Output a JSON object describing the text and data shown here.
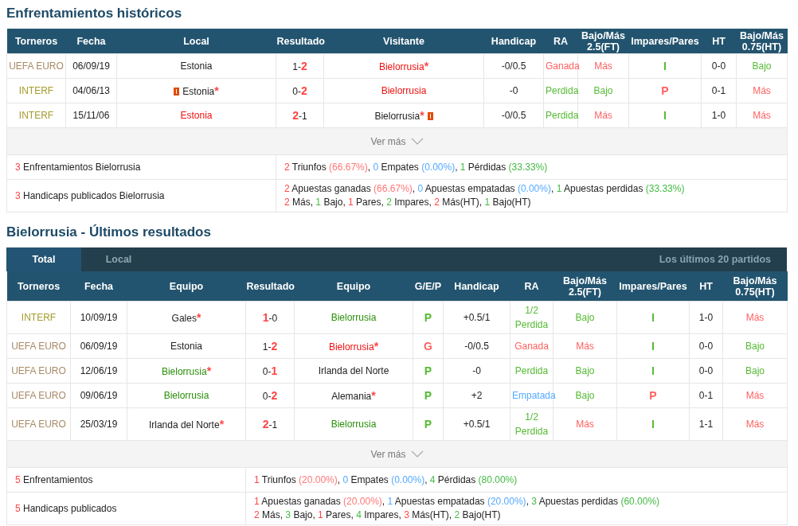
{
  "h2h": {
    "title": "Enfrentamientos históricos",
    "columns": [
      "Torneros",
      "Fecha",
      "Local",
      "Resultado",
      "Visitante",
      "Handicap",
      "RA",
      "Bajo/Más 2.5(FT)",
      "Impares/Pares",
      "HT",
      "Bajo/Más 0.75(HT)"
    ],
    "rows": [
      [
        {
          "text": "UEFA EURO",
          "color": "#a88a66"
        },
        {
          "text": "06/09/19"
        },
        {
          "text": "Estonia"
        },
        {
          "parts": [
            {
              "text": "1"
            },
            {
              "text": "-"
            },
            {
              "text": "2",
              "color": "#ff4444"
            }
          ]
        },
        {
          "parts": [
            {
              "text": "Bielorrusia",
              "color": "#ee1111"
            },
            {
              "text": "*",
              "color": "#ff4444"
            }
          ]
        },
        {
          "text": "-0/0.5"
        },
        {
          "text": "Ganada",
          "color": "#ff6060"
        },
        {
          "text": "Más",
          "color": "#ff6060"
        },
        {
          "text": "I",
          "color": "#55bb33"
        },
        {
          "text": "0-0"
        },
        {
          "text": "Bajo",
          "color": "#55bb33"
        }
      ],
      [
        {
          "text": "INTERF",
          "color": "#a59b2c"
        },
        {
          "text": "04/06/13"
        },
        {
          "card_before": true,
          "parts": [
            {
              "text": "Estonia"
            },
            {
              "text": "*",
              "color": "#ff4444"
            }
          ]
        },
        {
          "parts": [
            {
              "text": "0"
            },
            {
              "text": "-"
            },
            {
              "text": "2",
              "color": "#ff4444"
            }
          ]
        },
        {
          "text": "Bielorrusia",
          "color": "#ee1111"
        },
        {
          "text": "-0"
        },
        {
          "text": "Perdida",
          "color": "#55bb33"
        },
        {
          "text": "Bajo",
          "color": "#55bb33"
        },
        {
          "text": "P",
          "color": "#ff6060"
        },
        {
          "text": "0-1"
        },
        {
          "text": "Más",
          "color": "#ff6060"
        }
      ],
      [
        {
          "text": "INTERF",
          "color": "#a59b2c"
        },
        {
          "text": "15/11/06"
        },
        {
          "text": "Estonia",
          "color": "#ee1111"
        },
        {
          "parts": [
            {
              "text": "2",
              "color": "#ff4444"
            },
            {
              "text": "-"
            },
            {
              "text": "1"
            }
          ]
        },
        {
          "card_after": true,
          "parts": [
            {
              "text": "Bielorrusia"
            },
            {
              "text": "*",
              "color": "#ff4444"
            }
          ]
        },
        {
          "text": "-0/0.5"
        },
        {
          "text": "Perdida",
          "color": "#55bb33"
        },
        {
          "text": "Más",
          "color": "#ff6060"
        },
        {
          "text": "I",
          "color": "#55bb33"
        },
        {
          "text": "1-0"
        },
        {
          "text": "Más",
          "color": "#ff6060"
        }
      ]
    ],
    "more": "Ver más",
    "summary": [
      {
        "count": "3",
        "label": "Enfrentamientos Bielorrusia",
        "lines": [
          [
            {
              "text": "2",
              "color": "#ff4444"
            },
            {
              "text": " Triunfos "
            },
            {
              "text": "(66.67%)",
              "color": "#ff7777"
            },
            {
              "text": ", "
            },
            {
              "text": "0",
              "color": "#55aaff"
            },
            {
              "text": " Empates "
            },
            {
              "text": "(0.00%)",
              "color": "#55aaff"
            },
            {
              "text": ", "
            },
            {
              "text": "1",
              "color": "#44bb44"
            },
            {
              "text": " Pérdidas "
            },
            {
              "text": "(33.33%)",
              "color": "#44bb44"
            }
          ]
        ]
      },
      {
        "count": "3",
        "label": "Handicaps publicados Bielorrusia",
        "lines": [
          [
            {
              "text": "2",
              "color": "#ff4444"
            },
            {
              "text": " Apuestas ganadas "
            },
            {
              "text": "(66.67%)",
              "color": "#ff7777"
            },
            {
              "text": ", "
            },
            {
              "text": "0",
              "color": "#55aaff"
            },
            {
              "text": " Apuestas empatadas "
            },
            {
              "text": "(0.00%)",
              "color": "#55aaff"
            },
            {
              "text": ", "
            },
            {
              "text": "1",
              "color": "#44bb44"
            },
            {
              "text": " Apuestas perdidas "
            },
            {
              "text": "(33.33%)",
              "color": "#44bb44"
            }
          ],
          [
            {
              "text": "2",
              "color": "#ff4444"
            },
            {
              "text": " Más, "
            },
            {
              "text": "1",
              "color": "#44bb44"
            },
            {
              "text": " Bajo, "
            },
            {
              "text": "1",
              "color": "#ff4444"
            },
            {
              "text": " Pares, "
            },
            {
              "text": "2",
              "color": "#44bb44"
            },
            {
              "text": " Impares, "
            },
            {
              "text": "2",
              "color": "#ff4444"
            },
            {
              "text": " Más(HT), "
            },
            {
              "text": "1",
              "color": "#44bb44"
            },
            {
              "text": " Bajo(HT)"
            }
          ]
        ]
      }
    ]
  },
  "recent": {
    "title": "Bielorrusia - Últimos resultados",
    "tabs": [
      {
        "label": "Total",
        "selected": true
      },
      {
        "label": "Local",
        "selected": false
      }
    ],
    "note": "Los últimos 20 partidos",
    "columns": [
      "Torneros",
      "Fecha",
      "Equipo",
      "Resultado",
      "Equipo",
      "G/E/P",
      "Handicap",
      "RA",
      "Bajo/Más 2.5(FT)",
      "Impares/Pares",
      "HT",
      "Bajo/Más 0.75(HT)"
    ],
    "rows": [
      [
        {
          "text": "INTERF",
          "color": "#a59b2c"
        },
        {
          "text": "10/09/19"
        },
        {
          "parts": [
            {
              "text": "Gales"
            },
            {
              "text": "*",
              "color": "#ff4444"
            }
          ]
        },
        {
          "parts": [
            {
              "text": "1",
              "color": "#ff4444"
            },
            {
              "text": "-"
            },
            {
              "text": "0"
            }
          ]
        },
        {
          "text": "Bielorrusia",
          "color": "#2a8f0a"
        },
        {
          "text": "P",
          "color": "#55bb33"
        },
        {
          "text": "+0.5/1"
        },
        {
          "text": "1/2 Perdida",
          "color": "#55bb33"
        },
        {
          "text": "Bajo",
          "color": "#55bb33"
        },
        {
          "text": "I",
          "color": "#55bb33"
        },
        {
          "text": "1-0"
        },
        {
          "text": "Más",
          "color": "#ff6060"
        }
      ],
      [
        {
          "text": "UEFA EURO",
          "color": "#a88a66"
        },
        {
          "text": "06/09/19"
        },
        {
          "text": "Estonia"
        },
        {
          "parts": [
            {
              "text": "1"
            },
            {
              "text": "-"
            },
            {
              "text": "2",
              "color": "#ff4444"
            }
          ]
        },
        {
          "parts": [
            {
              "text": "Bielorrusia",
              "color": "#ee1111"
            },
            {
              "text": "*",
              "color": "#ff4444"
            }
          ]
        },
        {
          "text": "G",
          "color": "#ff6060"
        },
        {
          "text": "-0/0.5"
        },
        {
          "text": "Ganada",
          "color": "#ff6060"
        },
        {
          "text": "Más",
          "color": "#ff6060"
        },
        {
          "text": "I",
          "color": "#55bb33"
        },
        {
          "text": "0-0"
        },
        {
          "text": "Bajo",
          "color": "#55bb33"
        }
      ],
      [
        {
          "text": "UEFA EURO",
          "color": "#a88a66"
        },
        {
          "text": "12/06/19"
        },
        {
          "parts": [
            {
              "text": "Bielorrusia",
              "color": "#2a8f0a"
            },
            {
              "text": "*",
              "color": "#ff4444"
            }
          ]
        },
        {
          "parts": [
            {
              "text": "0"
            },
            {
              "text": "-"
            },
            {
              "text": "1",
              "color": "#ff4444"
            }
          ]
        },
        {
          "text": "Irlanda del Norte"
        },
        {
          "text": "P",
          "color": "#55bb33"
        },
        {
          "text": "-0"
        },
        {
          "text": "Perdida",
          "color": "#55bb33"
        },
        {
          "text": "Bajo",
          "color": "#55bb33"
        },
        {
          "text": "I",
          "color": "#55bb33"
        },
        {
          "text": "0-0"
        },
        {
          "text": "Bajo",
          "color": "#55bb33"
        }
      ],
      [
        {
          "text": "UEFA EURO",
          "color": "#a88a66"
        },
        {
          "text": "09/06/19"
        },
        {
          "text": "Bielorrusia",
          "color": "#2a8f0a"
        },
        {
          "parts": [
            {
              "text": "0"
            },
            {
              "text": "-"
            },
            {
              "text": "2",
              "color": "#ff4444"
            }
          ]
        },
        {
          "parts": [
            {
              "text": "Alemania"
            },
            {
              "text": "*",
              "color": "#ff4444"
            }
          ]
        },
        {
          "text": "P",
          "color": "#55bb33"
        },
        {
          "text": "+2"
        },
        {
          "text": "Empatada",
          "color": "#55aaff"
        },
        {
          "text": "Bajo",
          "color": "#55bb33"
        },
        {
          "text": "P",
          "color": "#ff6060"
        },
        {
          "text": "0-1"
        },
        {
          "text": "Más",
          "color": "#ff6060"
        }
      ],
      [
        {
          "text": "UEFA EURO",
          "color": "#a88a66"
        },
        {
          "text": "25/03/19"
        },
        {
          "parts": [
            {
              "text": "Irlanda del Norte"
            },
            {
              "text": "*",
              "color": "#ff4444"
            }
          ]
        },
        {
          "parts": [
            {
              "text": "2",
              "color": "#ff4444"
            },
            {
              "text": "-"
            },
            {
              "text": "1"
            }
          ]
        },
        {
          "text": "Bielorrusia",
          "color": "#2a8f0a"
        },
        {
          "text": "P",
          "color": "#55bb33"
        },
        {
          "text": "+0.5/1"
        },
        {
          "text": "1/2 Perdida",
          "color": "#55bb33"
        },
        {
          "text": "Más",
          "color": "#ff6060"
        },
        {
          "text": "I",
          "color": "#55bb33"
        },
        {
          "text": "1-1"
        },
        {
          "text": "Más",
          "color": "#ff6060"
        }
      ]
    ],
    "more": "Ver más",
    "summary": [
      {
        "count": "5",
        "label": "Enfrentamientos",
        "lines": [
          [
            {
              "text": "1",
              "color": "#ff4444"
            },
            {
              "text": " Triunfos "
            },
            {
              "text": "(20.00%)",
              "color": "#ff7777"
            },
            {
              "text": ", "
            },
            {
              "text": "0",
              "color": "#55aaff"
            },
            {
              "text": " Empates "
            },
            {
              "text": "(0.00%)",
              "color": "#55aaff"
            },
            {
              "text": ", "
            },
            {
              "text": "4",
              "color": "#44bb44"
            },
            {
              "text": " Pérdidas "
            },
            {
              "text": "(80.00%)",
              "color": "#44bb44"
            }
          ]
        ]
      },
      {
        "count": "5",
        "label": "Handicaps publicados",
        "lines": [
          [
            {
              "text": "1",
              "color": "#ff4444"
            },
            {
              "text": " Apuestas ganadas "
            },
            {
              "text": "(20.00%)",
              "color": "#ff7777"
            },
            {
              "text": ", "
            },
            {
              "text": "1",
              "color": "#55aaff"
            },
            {
              "text": " Apuestas empatadas "
            },
            {
              "text": "(20.00%)",
              "color": "#55aaff"
            },
            {
              "text": ", "
            },
            {
              "text": "3",
              "color": "#44bb44"
            },
            {
              "text": " Apuestas perdidas "
            },
            {
              "text": "(60.00%)",
              "color": "#44bb44"
            }
          ],
          [
            {
              "text": "2",
              "color": "#ff4444"
            },
            {
              "text": " Más, "
            },
            {
              "text": "3",
              "color": "#44bb44"
            },
            {
              "text": " Bajo, "
            },
            {
              "text": "1",
              "color": "#ff4444"
            },
            {
              "text": " Pares, "
            },
            {
              "text": "4",
              "color": "#44bb44"
            },
            {
              "text": " Impares, "
            },
            {
              "text": "3",
              "color": "#ff4444"
            },
            {
              "text": " Más(HT), "
            },
            {
              "text": "2",
              "color": "#44bb44"
            },
            {
              "text": " Bajo(HT)"
            }
          ]
        ]
      }
    ]
  }
}
